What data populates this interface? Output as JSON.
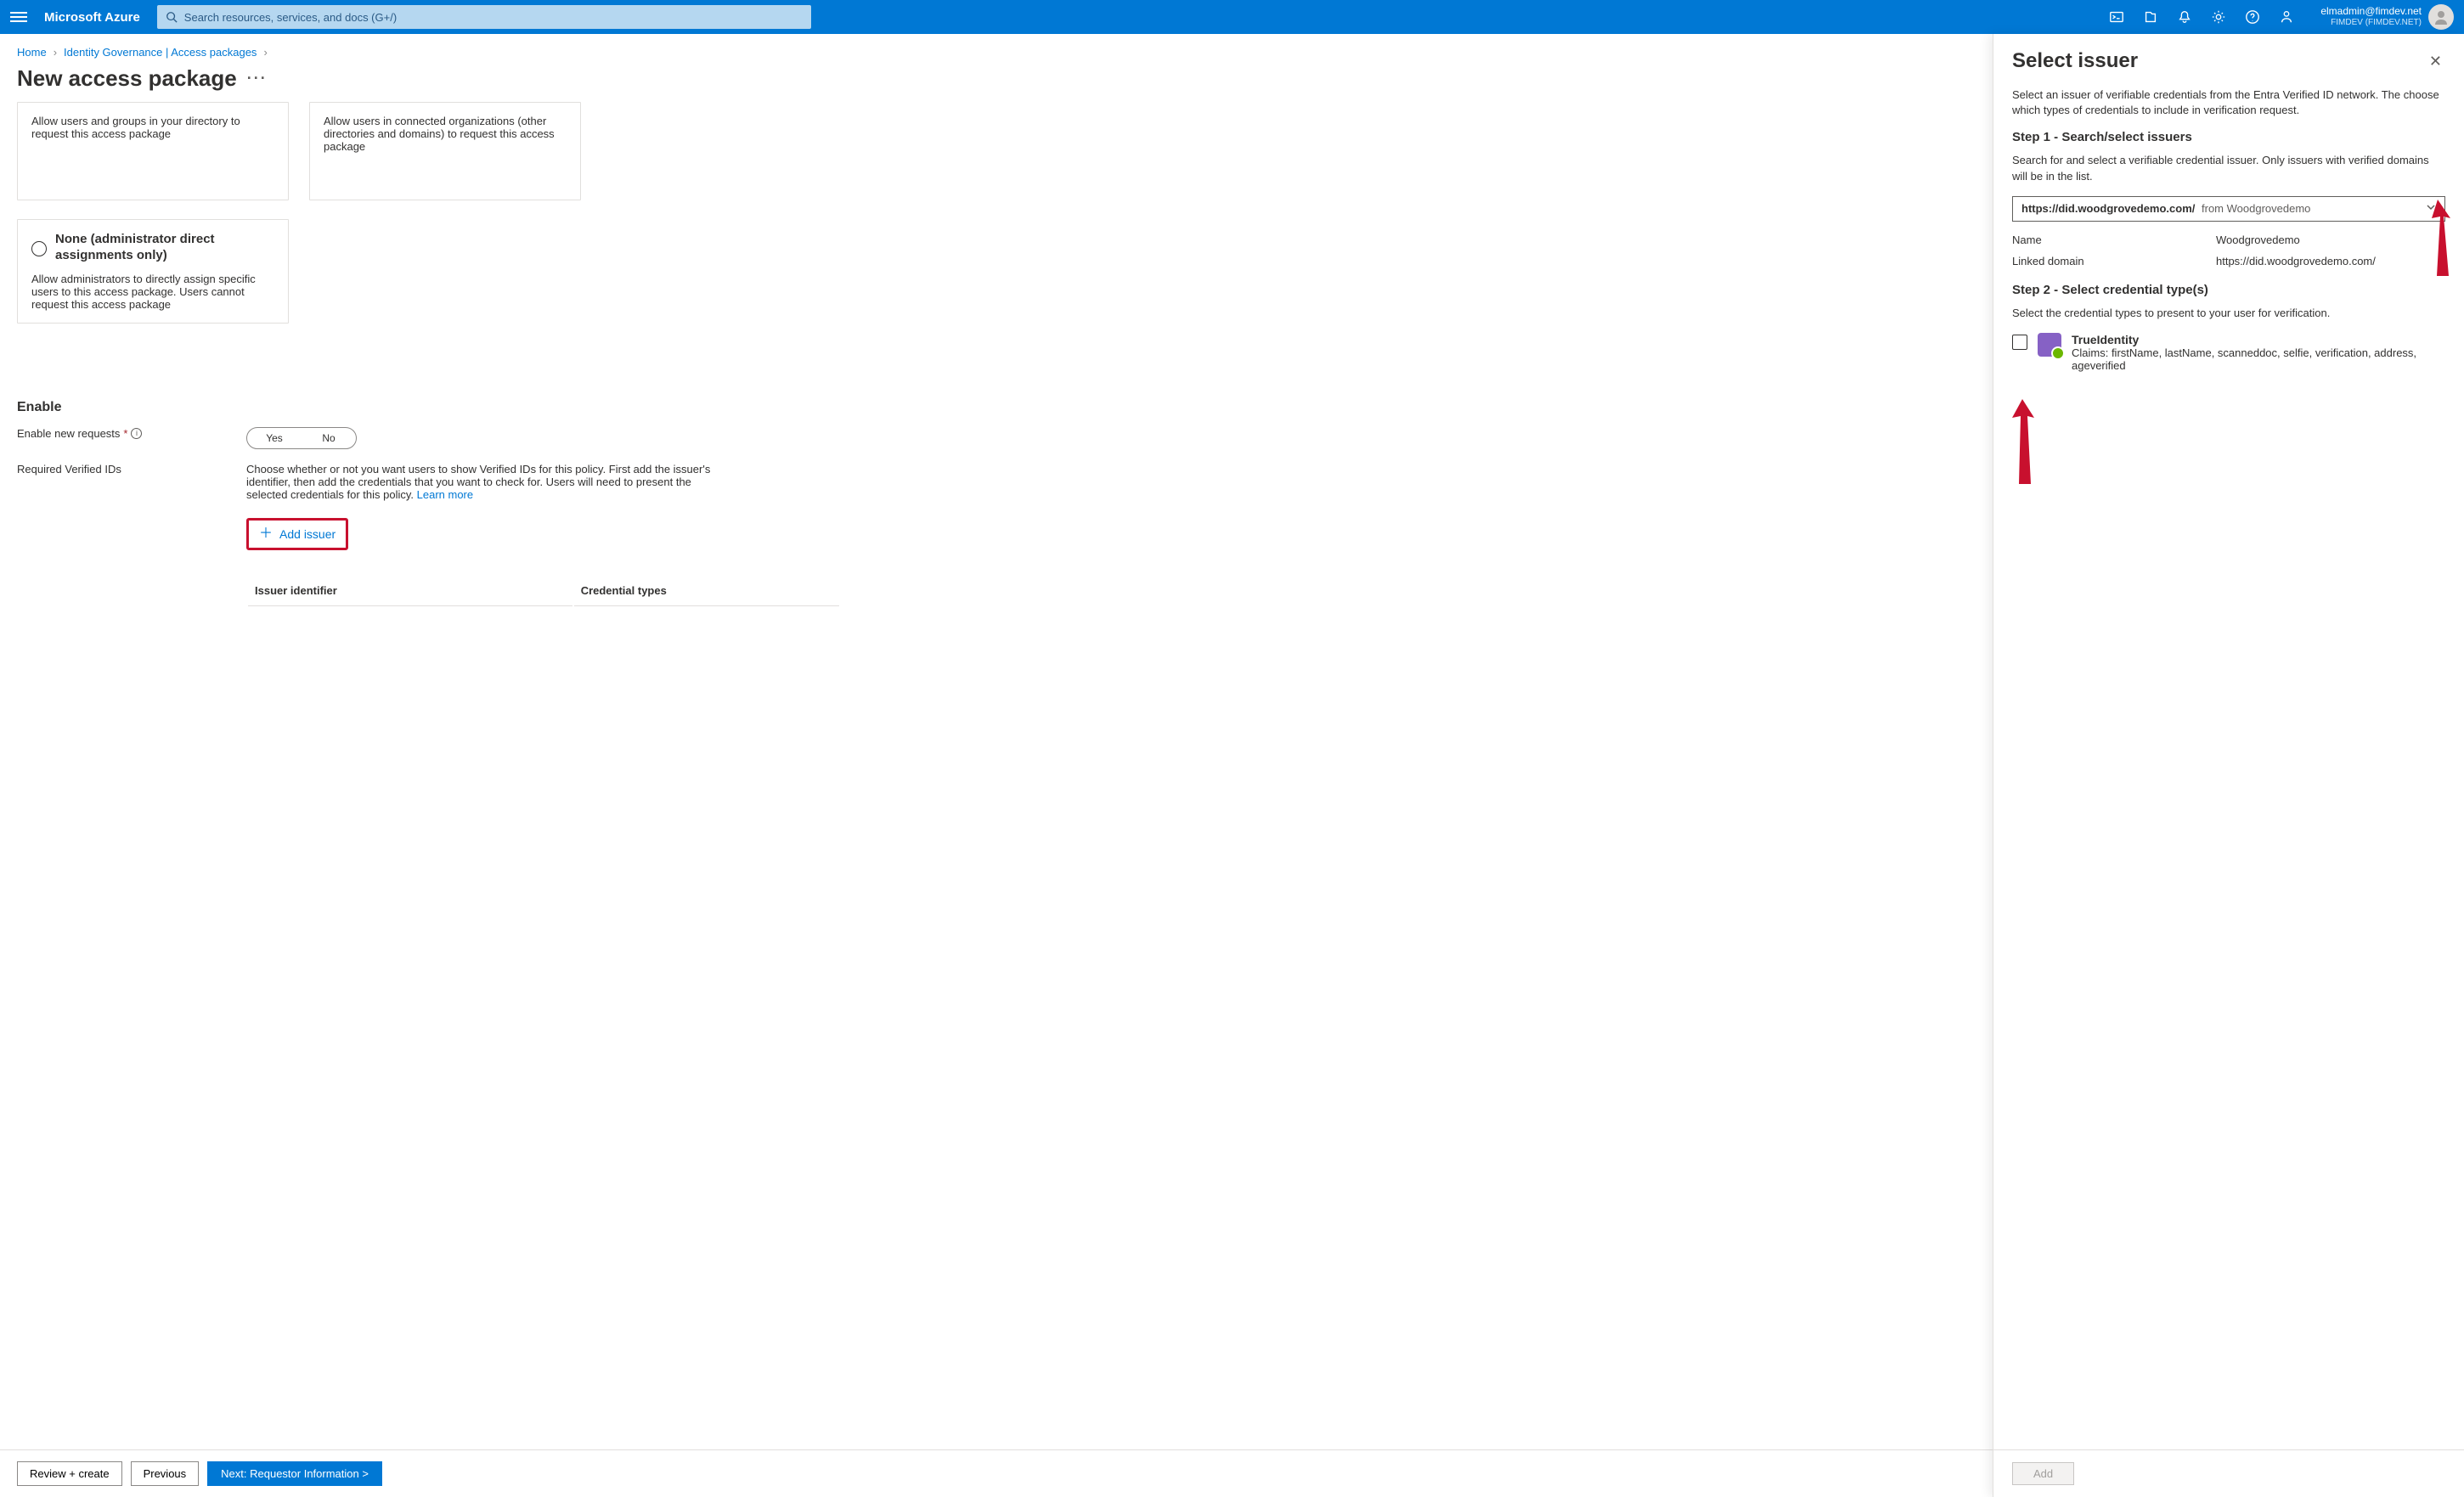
{
  "topbar": {
    "brand": "Microsoft Azure",
    "search_placeholder": "Search resources, services, and docs (G+/)",
    "account_email": "elmadmin@fimdev.net",
    "tenant": "FIMDEV (FIMDEV.NET)"
  },
  "breadcrumb": {
    "home": "Home",
    "gov": "Identity Governance | Access packages"
  },
  "page": {
    "title": "New access package"
  },
  "cards": {
    "dir": "Allow users and groups in your directory to request this access package",
    "conn": "Allow users in connected organizations (other directories and domains) to request this access package",
    "none_title": "None (administrator direct assignments only)",
    "none_desc": "Allow administrators to directly assign specific users to this access package. Users cannot request this access package"
  },
  "enable": {
    "heading": "Enable",
    "new_requests_label": "Enable new requests",
    "yes": "Yes",
    "no": "No",
    "verified_ids_label": "Required Verified IDs",
    "verified_ids_desc_a": "Choose whether or not you want users to show Verified IDs for this policy. First add the issuer's identifier, then add the credentials that you want to check for. Users will need to present the selected credentials for this policy. ",
    "learn_more": "Learn more",
    "add_issuer": "Add issuer",
    "col_id": "Issuer identifier",
    "col_types": "Credential types"
  },
  "footer": {
    "review": "Review + create",
    "prev": "Previous",
    "next": "Next: Requestor Information >"
  },
  "panel": {
    "title": "Select issuer",
    "intro": "Select an issuer of verifiable credentials from the Entra Verified ID network. The choose which types of credentials to include in verification request.",
    "step1": "Step 1 - Search/select issuers",
    "step1_desc": "Search for and select a verifiable credential issuer. Only issuers with verified domains will be in the list.",
    "sel_url": "https://did.woodgrovedemo.com/",
    "sel_from_label": "from",
    "sel_from": "Woodgrovedemo",
    "name_k": "Name",
    "name_v": "Woodgrovedemo",
    "domain_k": "Linked domain",
    "domain_v": "https://did.woodgrovedemo.com/",
    "step2": "Step 2 - Select credential type(s)",
    "step2_desc": "Select the credential types to present to your user for verification.",
    "cred_name": "TrueIdentity",
    "cred_claims": "Claims: firstName, lastName, scanneddoc, selfie, verification, address, ageverified",
    "add_btn": "Add"
  }
}
